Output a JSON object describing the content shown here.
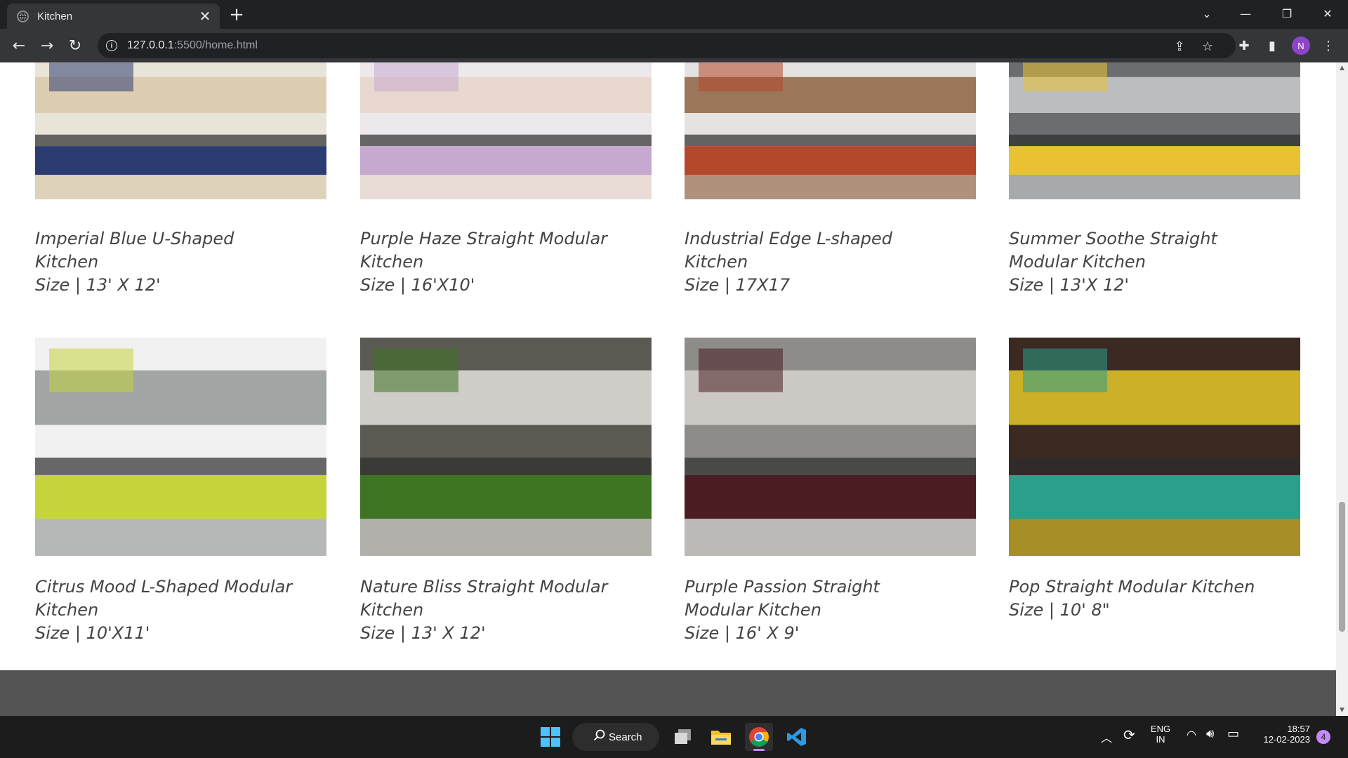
{
  "browser": {
    "tab_title": "Kitchen",
    "url_host": "127.0.0.1",
    "url_rest": ":5500/home.html",
    "profile_initial": "N"
  },
  "kitchens": [
    {
      "name": "Imperial Blue U-Shaped Kitchen",
      "size": "Size | 13' X 12'",
      "colors": [
        "#2b3c72",
        "#d9c7a8",
        "#e9e4d8"
      ]
    },
    {
      "name": "Purple Haze Straight Modular Kitchen",
      "size": "Size | 16'X10'",
      "colors": [
        "#c6a9cf",
        "#e6d3c8",
        "#ede8ec"
      ]
    },
    {
      "name": "Industrial Edge L-shaped Kitchen",
      "size": "Size | 17X17",
      "colors": [
        "#b5472a",
        "#8a5a38",
        "#e5e3e0"
      ]
    },
    {
      "name": "Summer Soothe Straight Modular Kitchen",
      "size": "Size | 13'X 12'",
      "colors": [
        "#e8c233",
        "#cfd1d3",
        "#6b6e70"
      ]
    },
    {
      "name": "Citrus Mood L-Shaped Modular Kitchen",
      "size": "Size | 10'X11'",
      "colors": [
        "#c6d43c",
        "#8d9290",
        "#f1f1f1"
      ]
    },
    {
      "name": "Nature Bliss Straight Modular Kitchen",
      "size": "Size | 13' X 12'",
      "colors": [
        "#3f7425",
        "#eceae6",
        "#5a5a52"
      ]
    },
    {
      "name": "Purple Passion Straight Modular Kitchen",
      "size": "Size | 16' X 9'",
      "colors": [
        "#4b1c22",
        "#dcd8d5",
        "#8d8c89"
      ]
    },
    {
      "name": "Pop Straight Modular Kitchen",
      "size": "Size | 10' 8\"",
      "colors": [
        "#2a9f8a",
        "#f1d22a",
        "#3a2a22"
      ]
    }
  ],
  "taskbar": {
    "search_label": "Search",
    "lang_top": "ENG",
    "lang_bottom": "IN",
    "time": "18:57",
    "date": "12-02-2023",
    "notification_count": "4"
  }
}
